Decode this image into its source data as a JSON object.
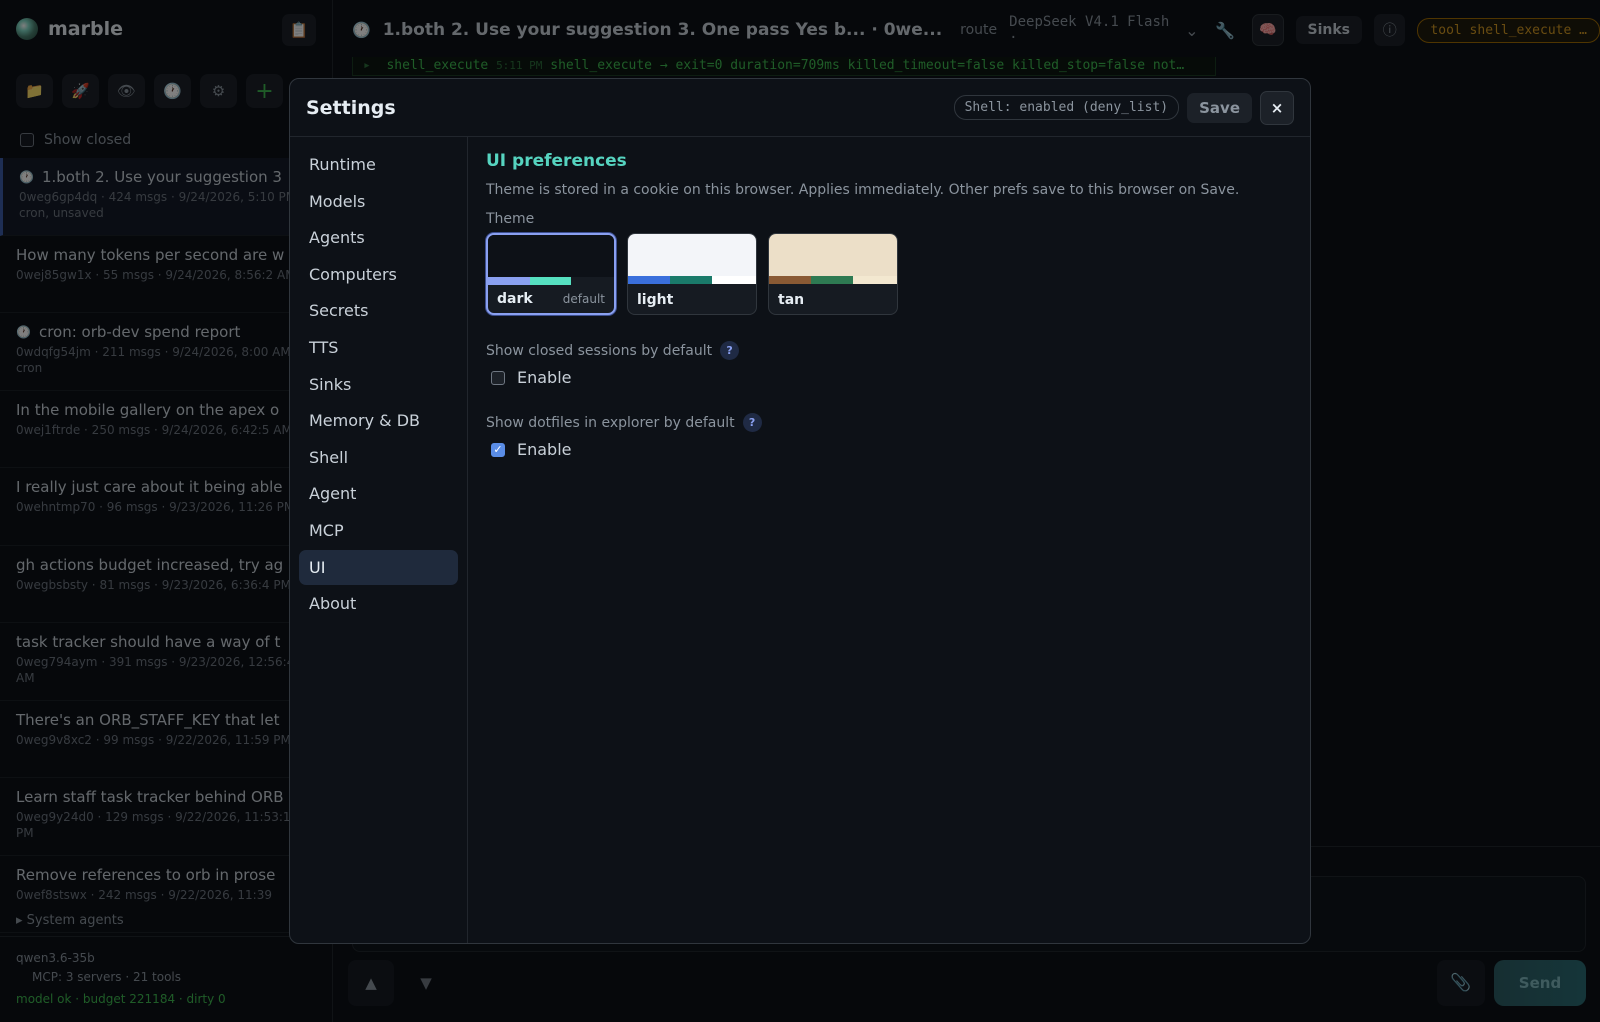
{
  "app": {
    "name": "marble"
  },
  "sidebar": {
    "show_closed_label": "Show closed",
    "sessions": [
      {
        "title": "1.both 2. Use your suggestion 3",
        "meta": "0weg6gp4dq · 424 msgs · 9/24/2026, 5:10 PM · cron, unsaved",
        "icon": true
      },
      {
        "title": "How many tokens per second are w",
        "meta": "0wej85gw1x · 55 msgs · 9/24/2026, 8:56:2 AM",
        "icon": false
      },
      {
        "title": "cron: orb-dev spend report",
        "meta": "0wdqfg54jm · 211 msgs · 9/24/2026, 8:00 AM · cron",
        "icon": true
      },
      {
        "title": "In the mobile gallery on the apex o",
        "meta": "0wej1ftrde · 250 msgs · 9/24/2026, 6:42:5 AM",
        "icon": false
      },
      {
        "title": "I really just care about it being able",
        "meta": "0wehntmp70 · 96 msgs · 9/23/2026, 11:26 PM",
        "icon": false
      },
      {
        "title": "gh actions budget increased, try ag",
        "meta": "0wegbsbsty · 81 msgs · 9/23/2026, 6:36:4 PM",
        "icon": false
      },
      {
        "title": "task tracker should have a way of t",
        "meta": "0weg794aym · 391 msgs · 9/23/2026, 12:56:46 AM",
        "icon": false
      },
      {
        "title": "There's an ORB_STAFF_KEY that let",
        "meta": "0weg9v8xc2 · 99 msgs · 9/22/2026, 11:59 PM",
        "icon": false
      },
      {
        "title": "Learn staff task tracker behind ORB",
        "meta": "0weg9y24d0 · 129 msgs · 9/22/2026, 11:53:10 PM",
        "icon": false
      },
      {
        "title": "Remove references to orb in prose",
        "meta": "0wef8stswx · 242 msgs · 9/22/2026, 11:39",
        "icon": false
      }
    ],
    "system_agents": "▸ System agents",
    "footer": {
      "model": "qwen3.6-35b",
      "mcp": "MCP: 3 servers · 21 tools",
      "status": "model ok · budget 221184 · dirty 0"
    }
  },
  "header": {
    "title": "1.both 2. Use your suggestion 3. One pass Yes b... · 0we...",
    "route": "route",
    "model": "DeepSeek V4.1 Flash ·",
    "sinks": "Sinks",
    "tool": "tool shell_execute …"
  },
  "log": {
    "arrow": "▸",
    "name": "shell_execute",
    "time": "5:11 PM",
    "text": "shell_execute → exit=0 duration=709ms killed_timeout=false killed_stop=false not…"
  },
  "composer": {
    "send": "Send"
  },
  "settings": {
    "title": "Settings",
    "shell_status": "Shell: enabled (deny_list)",
    "save": "Save",
    "close": "×",
    "nav": [
      "Runtime",
      "Models",
      "Agents",
      "Computers",
      "Secrets",
      "TTS",
      "Sinks",
      "Memory & DB",
      "Shell",
      "Agent",
      "MCP",
      "UI",
      "About"
    ],
    "active_nav": "UI",
    "ui": {
      "heading": "UI preferences",
      "description": "Theme is stored in a cookie on this browser. Applies immediately. Other prefs save to this browser on Save.",
      "theme_label": "Theme",
      "themes": [
        {
          "name": "dark",
          "badge": "default",
          "top": "#0d1117",
          "stripe": [
            "#8aa0f0",
            "#56e0c0",
            "#161b22"
          ],
          "selected": true
        },
        {
          "name": "light",
          "badge": "",
          "top": "#f3f5f9",
          "stripe": [
            "#3a6fdc",
            "#1a7a6a",
            "#ffffff"
          ],
          "selected": false
        },
        {
          "name": "tan",
          "badge": "",
          "top": "#ecdfc8",
          "stripe": [
            "#8a5a34",
            "#2e7a52",
            "#f3e8d0"
          ],
          "selected": false
        }
      ],
      "options": [
        {
          "label": "Show closed sessions by default",
          "help": "?",
          "enable_label": "Enable",
          "checked": false
        },
        {
          "label": "Show dotfiles in explorer by default",
          "help": "?",
          "enable_label": "Enable",
          "checked": true
        }
      ]
    }
  }
}
